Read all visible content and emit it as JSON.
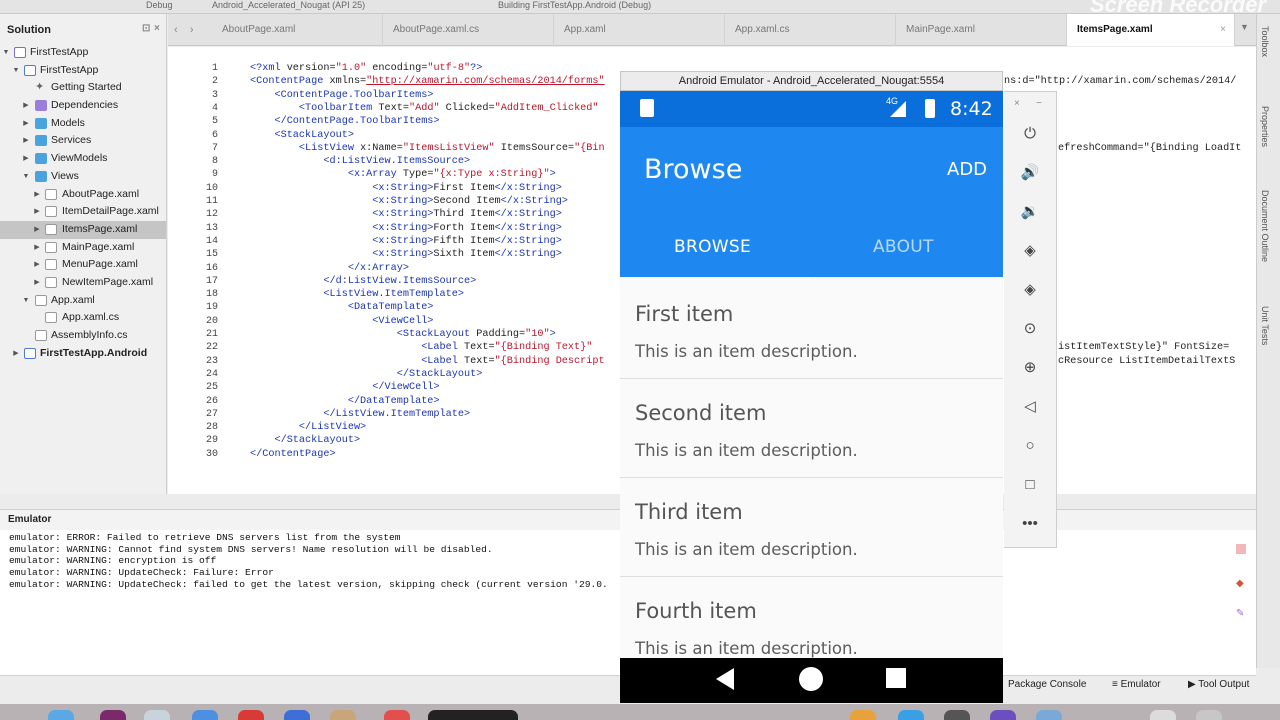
{
  "toolbar": {
    "config": "Debug",
    "device": "Android_Accelerated_Nougat (API 25)",
    "status": "Building FirstTestApp.Android (Debug)",
    "watermark": "Screen Recorder"
  },
  "solution_pad": {
    "title": "Solution",
    "items": [
      {
        "label": "FirstTestApp",
        "icon": "solution-icon"
      },
      {
        "label": "FirstTestApp",
        "icon": "project-icon"
      },
      {
        "label": "Getting Started",
        "icon": "getting-started-icon"
      },
      {
        "label": "Dependencies",
        "icon": "dependencies-icon"
      },
      {
        "label": "Models",
        "icon": "folder-icon"
      },
      {
        "label": "Services",
        "icon": "folder-icon"
      },
      {
        "label": "ViewModels",
        "icon": "folder-icon"
      },
      {
        "label": "Views",
        "icon": "folder-icon"
      },
      {
        "label": "AboutPage.xaml",
        "icon": "xaml-file-icon"
      },
      {
        "label": "ItemDetailPage.xaml",
        "icon": "xaml-file-icon"
      },
      {
        "label": "ItemsPage.xaml",
        "icon": "xaml-file-icon"
      },
      {
        "label": "MainPage.xaml",
        "icon": "xaml-file-icon"
      },
      {
        "label": "MenuPage.xaml",
        "icon": "xaml-file-icon"
      },
      {
        "label": "NewItemPage.xaml",
        "icon": "xaml-file-icon"
      },
      {
        "label": "App.xaml",
        "icon": "xaml-file-icon"
      },
      {
        "label": "App.xaml.cs",
        "icon": "cs-file-icon"
      },
      {
        "label": "AssemblyInfo.cs",
        "icon": "cs-file-icon"
      },
      {
        "label": "FirstTestApp.Android",
        "icon": "project-icon"
      }
    ]
  },
  "editor": {
    "tabs": [
      "AboutPage.xaml",
      "AboutPage.xaml.cs",
      "App.xaml",
      "App.xaml.cs",
      "MainPage.xaml",
      "ItemsPage.xaml"
    ],
    "active_tab": "ItemsPage.xaml",
    "lines": [
      "1",
      "2",
      "3",
      "4",
      "5",
      "6",
      "7",
      "8",
      "9",
      "10",
      "11",
      "12",
      "13",
      "14",
      "15",
      "16",
      "17",
      "18",
      "19",
      "20",
      "21",
      "22",
      "23",
      "24",
      "25",
      "26",
      "27",
      "28",
      "29",
      "30"
    ],
    "right_overflow": [
      "ns:d=\"http://xamarin.com/schemas/2014/",
      "efreshCommand=\"{Binding LoadIt",
      "istItemTextStyle}\" FontSize=",
      "cResource ListItemDetailTextS"
    ]
  },
  "right_tabs": [
    "Toolbox",
    "Properties",
    "Document Outline",
    "Unit Tests"
  ],
  "output_pad": {
    "title": "Emulator",
    "lines": [
      "emulator: ERROR: Failed to retrieve DNS servers list from the system",
      "emulator: WARNING: Cannot find system DNS servers! Name resolution will be disabled.",
      "emulator: WARNING: encryption is off",
      "emulator: WARNING: UpdateCheck: Failure: Error",
      "emulator: WARNING: UpdateCheck: failed to get the latest version, skipping check (current version '29.0."
    ]
  },
  "bottom_bar": {
    "package_console": "Package Console",
    "emulator": "Emulator",
    "tool_output": "Tool Output"
  },
  "emulator": {
    "window_title": "Android Emulator - Android_Accelerated_Nougat:5554",
    "status_time": "8:42",
    "network": "4G",
    "app_title": "Browse",
    "add_button": "ADD",
    "tabs": {
      "browse": "BROWSE",
      "about": "ABOUT"
    },
    "items": [
      {
        "title": "First item",
        "desc": "This is an item description."
      },
      {
        "title": "Second item",
        "desc": "This is an item description."
      },
      {
        "title": "Third item",
        "desc": "This is an item description."
      },
      {
        "title": "Fourth item",
        "desc": "This is an item description."
      }
    ],
    "colors": {
      "status_bar": "#0a6fdb",
      "app_bar": "#1e88f0"
    }
  }
}
